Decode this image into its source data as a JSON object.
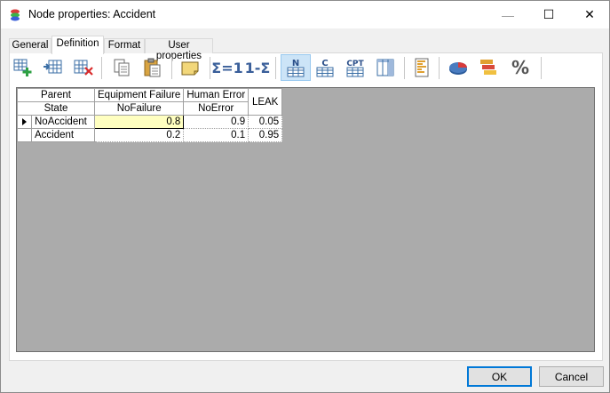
{
  "window": {
    "title": "Node properties: Accident",
    "minimize_glyph": "—",
    "maximize_glyph": "☐",
    "close_glyph": "✕"
  },
  "tabs": [
    {
      "label": "General",
      "active": false
    },
    {
      "label": "Definition",
      "active": true
    },
    {
      "label": "Format",
      "active": false
    },
    {
      "label": "User properties",
      "active": false
    }
  ],
  "toolbar": {
    "items": [
      {
        "icon": "add-row-icon"
      },
      {
        "icon": "insert-row-icon"
      },
      {
        "icon": "delete-row-icon"
      },
      {
        "icon": "copy-icon"
      },
      {
        "icon": "paste-icon"
      },
      {
        "icon": "note-icon"
      },
      {
        "icon": "normalize-icon",
        "text": "Σ=1"
      },
      {
        "icon": "complement-icon",
        "text": "1-Σ"
      },
      {
        "icon": "noisy-max-view-icon",
        "text": "N",
        "active": true
      },
      {
        "icon": "compound-view-icon",
        "text": "C"
      },
      {
        "icon": "cpt-view-icon",
        "text": "CPT"
      },
      {
        "icon": "column-view-icon"
      },
      {
        "icon": "bar-chart-icon"
      },
      {
        "icon": "pie-chart-icon"
      },
      {
        "icon": "stacked-bar-icon"
      },
      {
        "icon": "percent-icon",
        "text": "%"
      }
    ]
  },
  "table": {
    "parent_label": "Parent",
    "state_label": "State",
    "leak_label": "LEAK",
    "parents": [
      {
        "name": "Equipment Failure",
        "state": "NoFailure"
      },
      {
        "name": "Human Error",
        "state": "NoError"
      }
    ],
    "rows": [
      {
        "state": "NoAccident",
        "values": [
          "0.8",
          "0.9",
          "0.05"
        ],
        "current": true
      },
      {
        "state": "Accident",
        "values": [
          "0.2",
          "0.1",
          "0.95"
        ],
        "current": false
      }
    ]
  },
  "buttons": {
    "ok": "OK",
    "cancel": "Cancel"
  }
}
